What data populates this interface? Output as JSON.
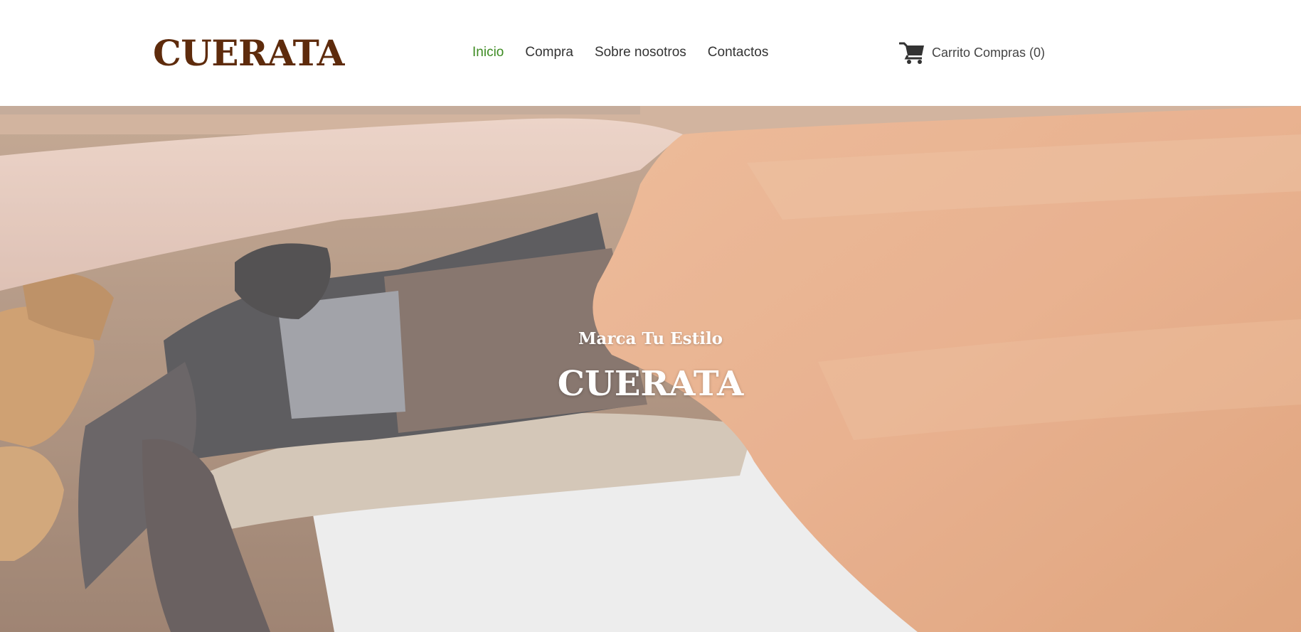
{
  "brand": {
    "name": "CUERATA",
    "color": "#5e2b0c"
  },
  "nav": {
    "items": [
      {
        "label": "Inicio",
        "active": true
      },
      {
        "label": "Compra",
        "active": false
      },
      {
        "label": "Sobre nosotros",
        "active": false
      },
      {
        "label": "Contactos",
        "active": false
      }
    ],
    "active_color": "#3d8b22"
  },
  "cart": {
    "icon": "shopping-cart-icon",
    "label": "Carrito Compras (0)"
  },
  "hero": {
    "subtitle": "Marca Tu Estilo",
    "title": "CUERATA",
    "image": "leather-hides-photo"
  }
}
